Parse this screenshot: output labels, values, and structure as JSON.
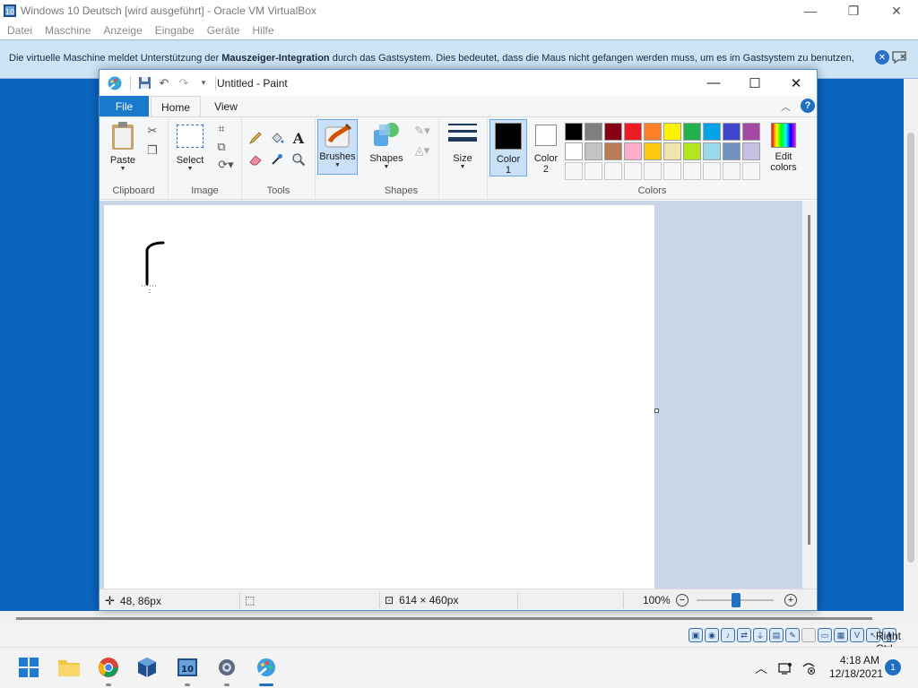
{
  "host": {
    "title": "Windows 10 Deutsch [wird ausgeführt] - Oracle VM VirtualBox",
    "menu": [
      "Datei",
      "Maschine",
      "Anzeige",
      "Eingabe",
      "Geräte",
      "Hilfe"
    ],
    "notice": {
      "before": "Die virtuelle Maschine meldet Unterstützung der ",
      "bold": "Mauszeiger-Integration",
      "after": " durch das Gastsystem. Dies bedeutet, dass die Maus nicht gefangen werden muss, um es im Gastsystem zu benutzen,"
    },
    "host_key": "Right Ctrl"
  },
  "paint": {
    "title": "Untitled - Paint",
    "tabs": {
      "file": "File",
      "home": "Home",
      "view": "View"
    },
    "groups": {
      "clipboard": "Clipboard",
      "image": "Image",
      "tools": "Tools",
      "shapes": "Shapes",
      "colors": "Colors"
    },
    "buttons": {
      "paste": "Paste",
      "select": "Select",
      "brushes": "Brushes",
      "shapes": "Shapes",
      "size": "Size",
      "color1_a": "Color",
      "color1_b": "1",
      "color2_a": "Color",
      "color2_b": "2",
      "edit_colors_a": "Edit",
      "edit_colors_b": "colors"
    },
    "palette_row1": [
      "#000000",
      "#7f7f7f",
      "#880015",
      "#ed1c24",
      "#ff7f27",
      "#fff200",
      "#22b14c",
      "#00a2e8",
      "#3f48cc",
      "#a349a4"
    ],
    "palette_row2": [
      "#ffffff",
      "#c3c3c3",
      "#b97a57",
      "#ffaec9",
      "#ffc90e",
      "#efe4b0",
      "#b5e61d",
      "#99d9ea",
      "#7092be",
      "#c8bfe7"
    ],
    "color1": "#000000",
    "color2": "#ffffff",
    "status": {
      "cursor": "48, 86px",
      "size": "614 × 460px",
      "zoom": "100%"
    }
  },
  "taskbar": {
    "time": "4:18 AM",
    "date": "12/18/2021",
    "notifications": "1"
  }
}
